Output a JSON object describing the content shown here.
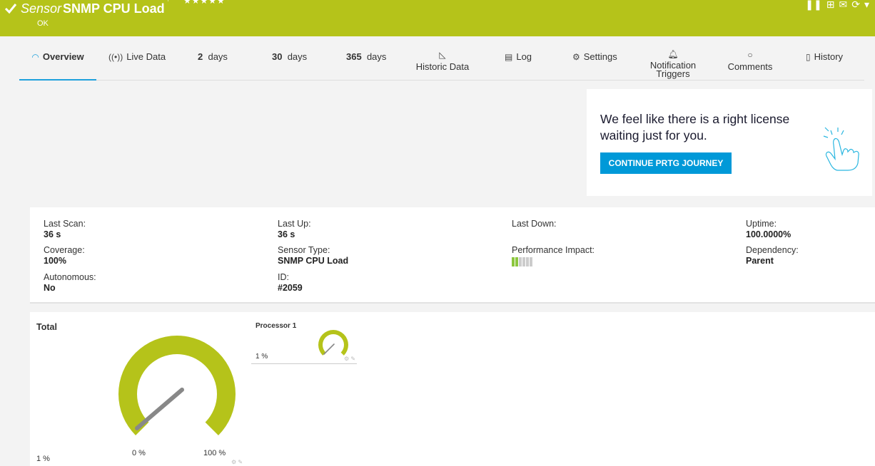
{
  "header": {
    "type_label": "Sensor",
    "name": "SNMP CPU Load",
    "status": "OK",
    "stars": "★★★★★",
    "color": "#b5c31a"
  },
  "tabs": [
    {
      "label": "Overview",
      "icon": "gauge-icon",
      "active": true
    },
    {
      "label": "Live Data",
      "icon": "broadcast-icon"
    },
    {
      "num": "2",
      "label": "days"
    },
    {
      "num": "30",
      "label": "days"
    },
    {
      "num": "365",
      "label": "days"
    },
    {
      "label": "Historic Data",
      "icon": "area-chart-icon"
    },
    {
      "label": "Log",
      "icon": "list-icon"
    },
    {
      "label": "Settings",
      "icon": "gear-icon"
    },
    {
      "label": "Notification Triggers",
      "line1": "Notification",
      "line2": "Triggers",
      "icon": "bell-icon"
    },
    {
      "label": "Comments",
      "icon": "comment-icon"
    },
    {
      "label": "History",
      "icon": "history-icon"
    }
  ],
  "license": {
    "text": "We feel like there is a right license waiting just for you.",
    "button": "CONTINUE PRTG JOURNEY",
    "accent": "#0099d8"
  },
  "info": {
    "last_scan": {
      "label": "Last Scan:",
      "value": "36 s"
    },
    "last_up": {
      "label": "Last Up:",
      "value": "36 s"
    },
    "last_down": {
      "label": "Last Down:",
      "value": ""
    },
    "uptime": {
      "label": "Uptime:",
      "value": "100.0000%"
    },
    "coverage": {
      "label": "Coverage:",
      "value": "100%"
    },
    "sensor_type": {
      "label": "Sensor Type:",
      "value": "SNMP CPU Load"
    },
    "performance_impact": {
      "label": "Performance Impact:",
      "level": 2,
      "max": 6
    },
    "dependency": {
      "label": "Dependency:",
      "value": "Parent"
    },
    "autonomous": {
      "label": "Autonomous:",
      "value": "No"
    },
    "id": {
      "label": "ID:",
      "value": "#2059"
    }
  },
  "gauges": {
    "total": {
      "title": "Total",
      "value_label": "1 %",
      "min_label": "0 %",
      "max_label": "100 %",
      "value": 1
    },
    "processor1": {
      "title": "Processor 1",
      "value_label": "1 %",
      "value": 1
    }
  }
}
